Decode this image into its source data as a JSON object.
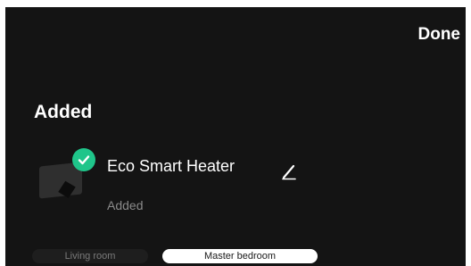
{
  "header": {
    "done_label": "Done"
  },
  "section": {
    "title": "Added"
  },
  "device": {
    "name": "Eco Smart Heater",
    "status": "Added",
    "icon": "heater-device-icon"
  },
  "rooms": {
    "tabs": [
      {
        "label": "Living room",
        "selected": false
      },
      {
        "label": "Master bedroom",
        "selected": true
      }
    ]
  },
  "colors": {
    "background": "#141414",
    "accent_check": "#1fc58a",
    "text_primary": "#ffffff",
    "text_secondary": "#8a8a8a"
  }
}
